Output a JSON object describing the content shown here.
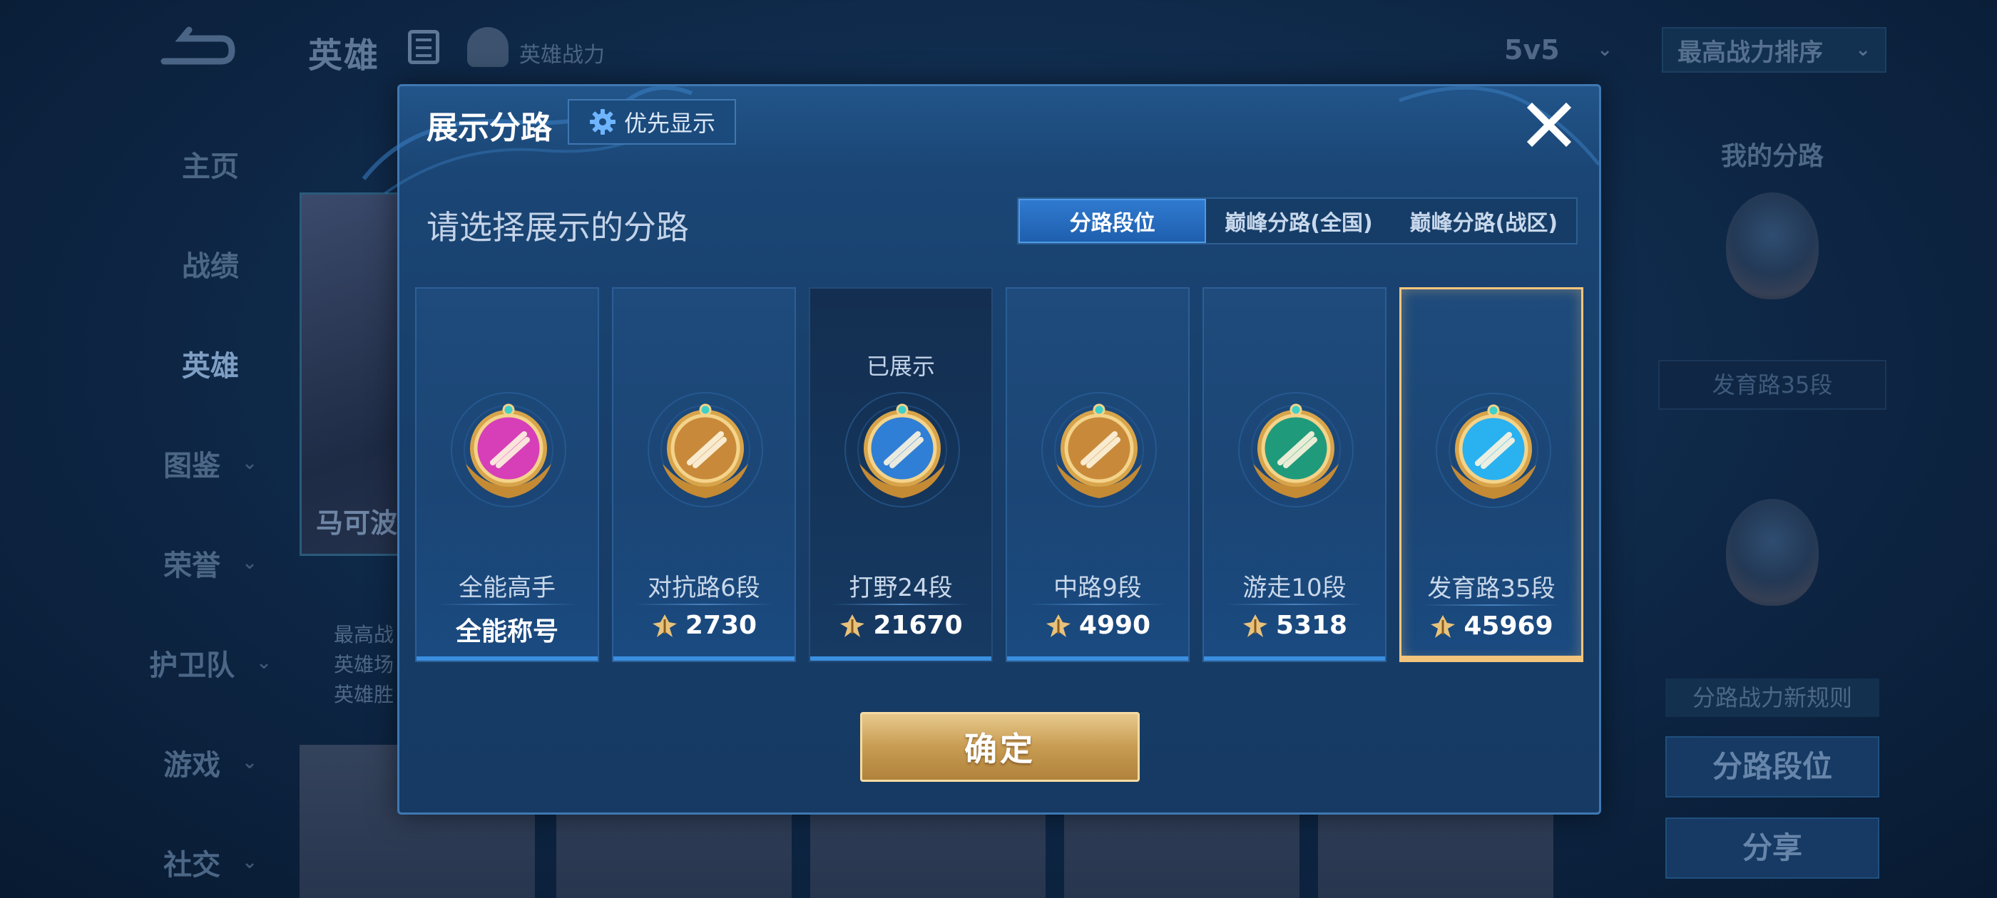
{
  "background": {
    "top_title": "英雄",
    "top_power_label": "英雄战力",
    "mode_dropdown": "5v5",
    "sort_dropdown": "最高战力排序",
    "side_nav": [
      {
        "label": "主页",
        "has_chevron": false,
        "active": false
      },
      {
        "label": "战绩",
        "has_chevron": false,
        "active": false
      },
      {
        "label": "英雄",
        "has_chevron": false,
        "active": true
      },
      {
        "label": "图鉴",
        "has_chevron": true,
        "active": false
      },
      {
        "label": "荣誉",
        "has_chevron": true,
        "active": false
      },
      {
        "label": "护卫队",
        "has_chevron": true,
        "active": false
      },
      {
        "label": "游戏",
        "has_chevron": true,
        "active": false
      },
      {
        "label": "社交",
        "has_chevron": true,
        "active": false
      }
    ],
    "hero_card_name": "马可波",
    "hero_meta_lines": [
      "最高战",
      "英雄场",
      "英雄胜"
    ],
    "right_panel": {
      "title": "我的分路",
      "lane_label": "发育路35段",
      "rule_link": "分路战力新规则",
      "lane_rank_button": "分路段位",
      "share_button": "分享"
    }
  },
  "modal": {
    "title": "展示分路",
    "priority_button": "优先显示",
    "select_label": "请选择展示的分路",
    "tabs": [
      {
        "label": "分路段位",
        "active": true
      },
      {
        "label": "巅峰分路(全国)",
        "active": false
      },
      {
        "label": "巅峰分路(战区)",
        "active": false
      }
    ],
    "cards": [
      {
        "title": "全能高手",
        "value": "全能称号",
        "show_power_icon": false,
        "tag": "",
        "badge": "allround-badge-icon",
        "badge_color": "#d63fb8",
        "selected": false,
        "dark": false
      },
      {
        "title": "对抗路6段",
        "value": "2730",
        "show_power_icon": true,
        "tag": "",
        "badge": "clash-lane-badge-icon",
        "badge_color": "#c88a3a",
        "selected": false,
        "dark": false
      },
      {
        "title": "打野24段",
        "value": "21670",
        "show_power_icon": true,
        "tag": "已展示",
        "badge": "jungle-badge-icon",
        "badge_color": "#2f7fd6",
        "selected": false,
        "dark": true
      },
      {
        "title": "中路9段",
        "value": "4990",
        "show_power_icon": true,
        "tag": "",
        "badge": "mid-lane-badge-icon",
        "badge_color": "#c88a3a",
        "selected": false,
        "dark": false
      },
      {
        "title": "游走10段",
        "value": "5318",
        "show_power_icon": true,
        "tag": "",
        "badge": "roam-badge-icon",
        "badge_color": "#1f9b7c",
        "selected": false,
        "dark": false
      },
      {
        "title": "发育路35段",
        "value": "45969",
        "show_power_icon": true,
        "tag": "",
        "badge": "farm-lane-badge-icon",
        "badge_color": "#2ab1f0",
        "selected": true,
        "dark": false
      }
    ],
    "confirm_button": "确定"
  }
}
